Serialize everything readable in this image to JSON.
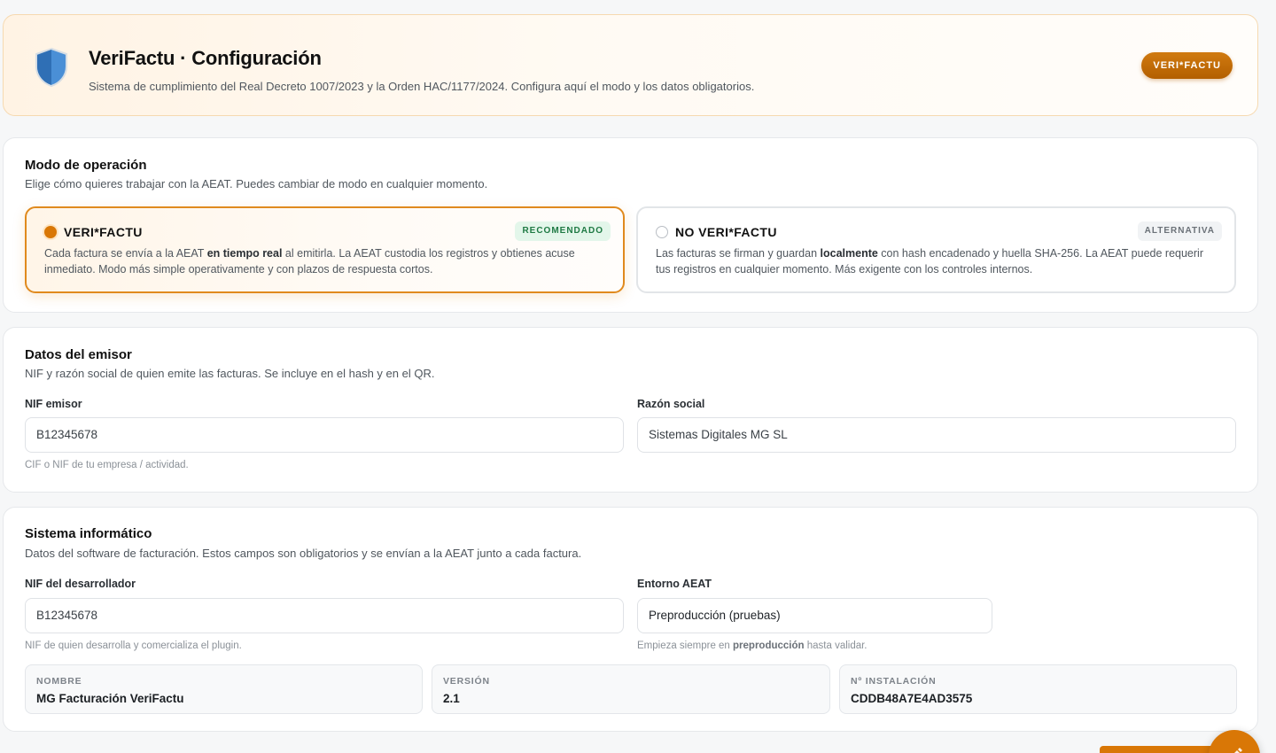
{
  "header": {
    "title": "VeriFactu · Configuración",
    "subtitle": "Sistema de cumplimiento del Real Decreto 1007/2023 y la Orden HAC/1177/2024. Configura aquí el modo y los datos obligatorios.",
    "badge": "VERI*FACTU",
    "icon": "shield-icon"
  },
  "mode_section": {
    "title": "Modo de operación",
    "subtitle": "Elige cómo quieres trabajar con la AEAT. Puedes cambiar de modo en cualquier momento.",
    "options": [
      {
        "title": "VERI*FACTU",
        "badge": "RECOMENDADO",
        "selected": true,
        "desc_1": "Cada factura se envía a la AEAT ",
        "desc_bold": "en tiempo real",
        "desc_2": " al emitirla. La AEAT custodia los registros y obtienes acuse inmediato. Modo más simple operativamente y con plazos de respuesta cortos."
      },
      {
        "title": "NO VERI*FACTU",
        "badge": "ALTERNATIVA",
        "selected": false,
        "desc_1": "Las facturas se firman y guardan ",
        "desc_bold": "localmente",
        "desc_2": " con hash encadenado y huella SHA-256. La AEAT puede requerir tus registros en cualquier momento. Más exigente con los controles internos."
      }
    ]
  },
  "emisor_section": {
    "title": "Datos del emisor",
    "subtitle": "NIF y razón social de quien emite las facturas. Se incluye en el hash y en el QR.",
    "nif_label": "NIF emisor",
    "nif_value": "B12345678",
    "nif_hint": "CIF o NIF de tu empresa / actividad.",
    "razon_label": "Razón social",
    "razon_value": "Sistemas Digitales MG SL"
  },
  "sistema_section": {
    "title": "Sistema informático",
    "subtitle": "Datos del software de facturación. Estos campos son obligatorios y se envían a la AEAT junto a cada factura.",
    "nif_dev_label": "NIF del desarrollador",
    "nif_dev_value": "B12345678",
    "nif_dev_hint": "NIF de quien desarrolla y comercializa el plugin.",
    "entorno_label": "Entorno AEAT",
    "entorno_value": "Preproducción (pruebas)",
    "entorno_hint_1": "Empieza siempre en ",
    "entorno_hint_bold": "preproducción",
    "entorno_hint_2": " hasta validar.",
    "info": [
      {
        "key": "NOMBRE",
        "value": "MG Facturación VeriFactu"
      },
      {
        "key": "VERSIÓN",
        "value": "2.1"
      },
      {
        "key": "Nº INSTALACIÓN",
        "value": "CDDB48A7E4AD3575"
      }
    ]
  },
  "colors": {
    "accent": "#d97706",
    "accent_light": "#fff5e8",
    "success": "#1f7a44"
  }
}
